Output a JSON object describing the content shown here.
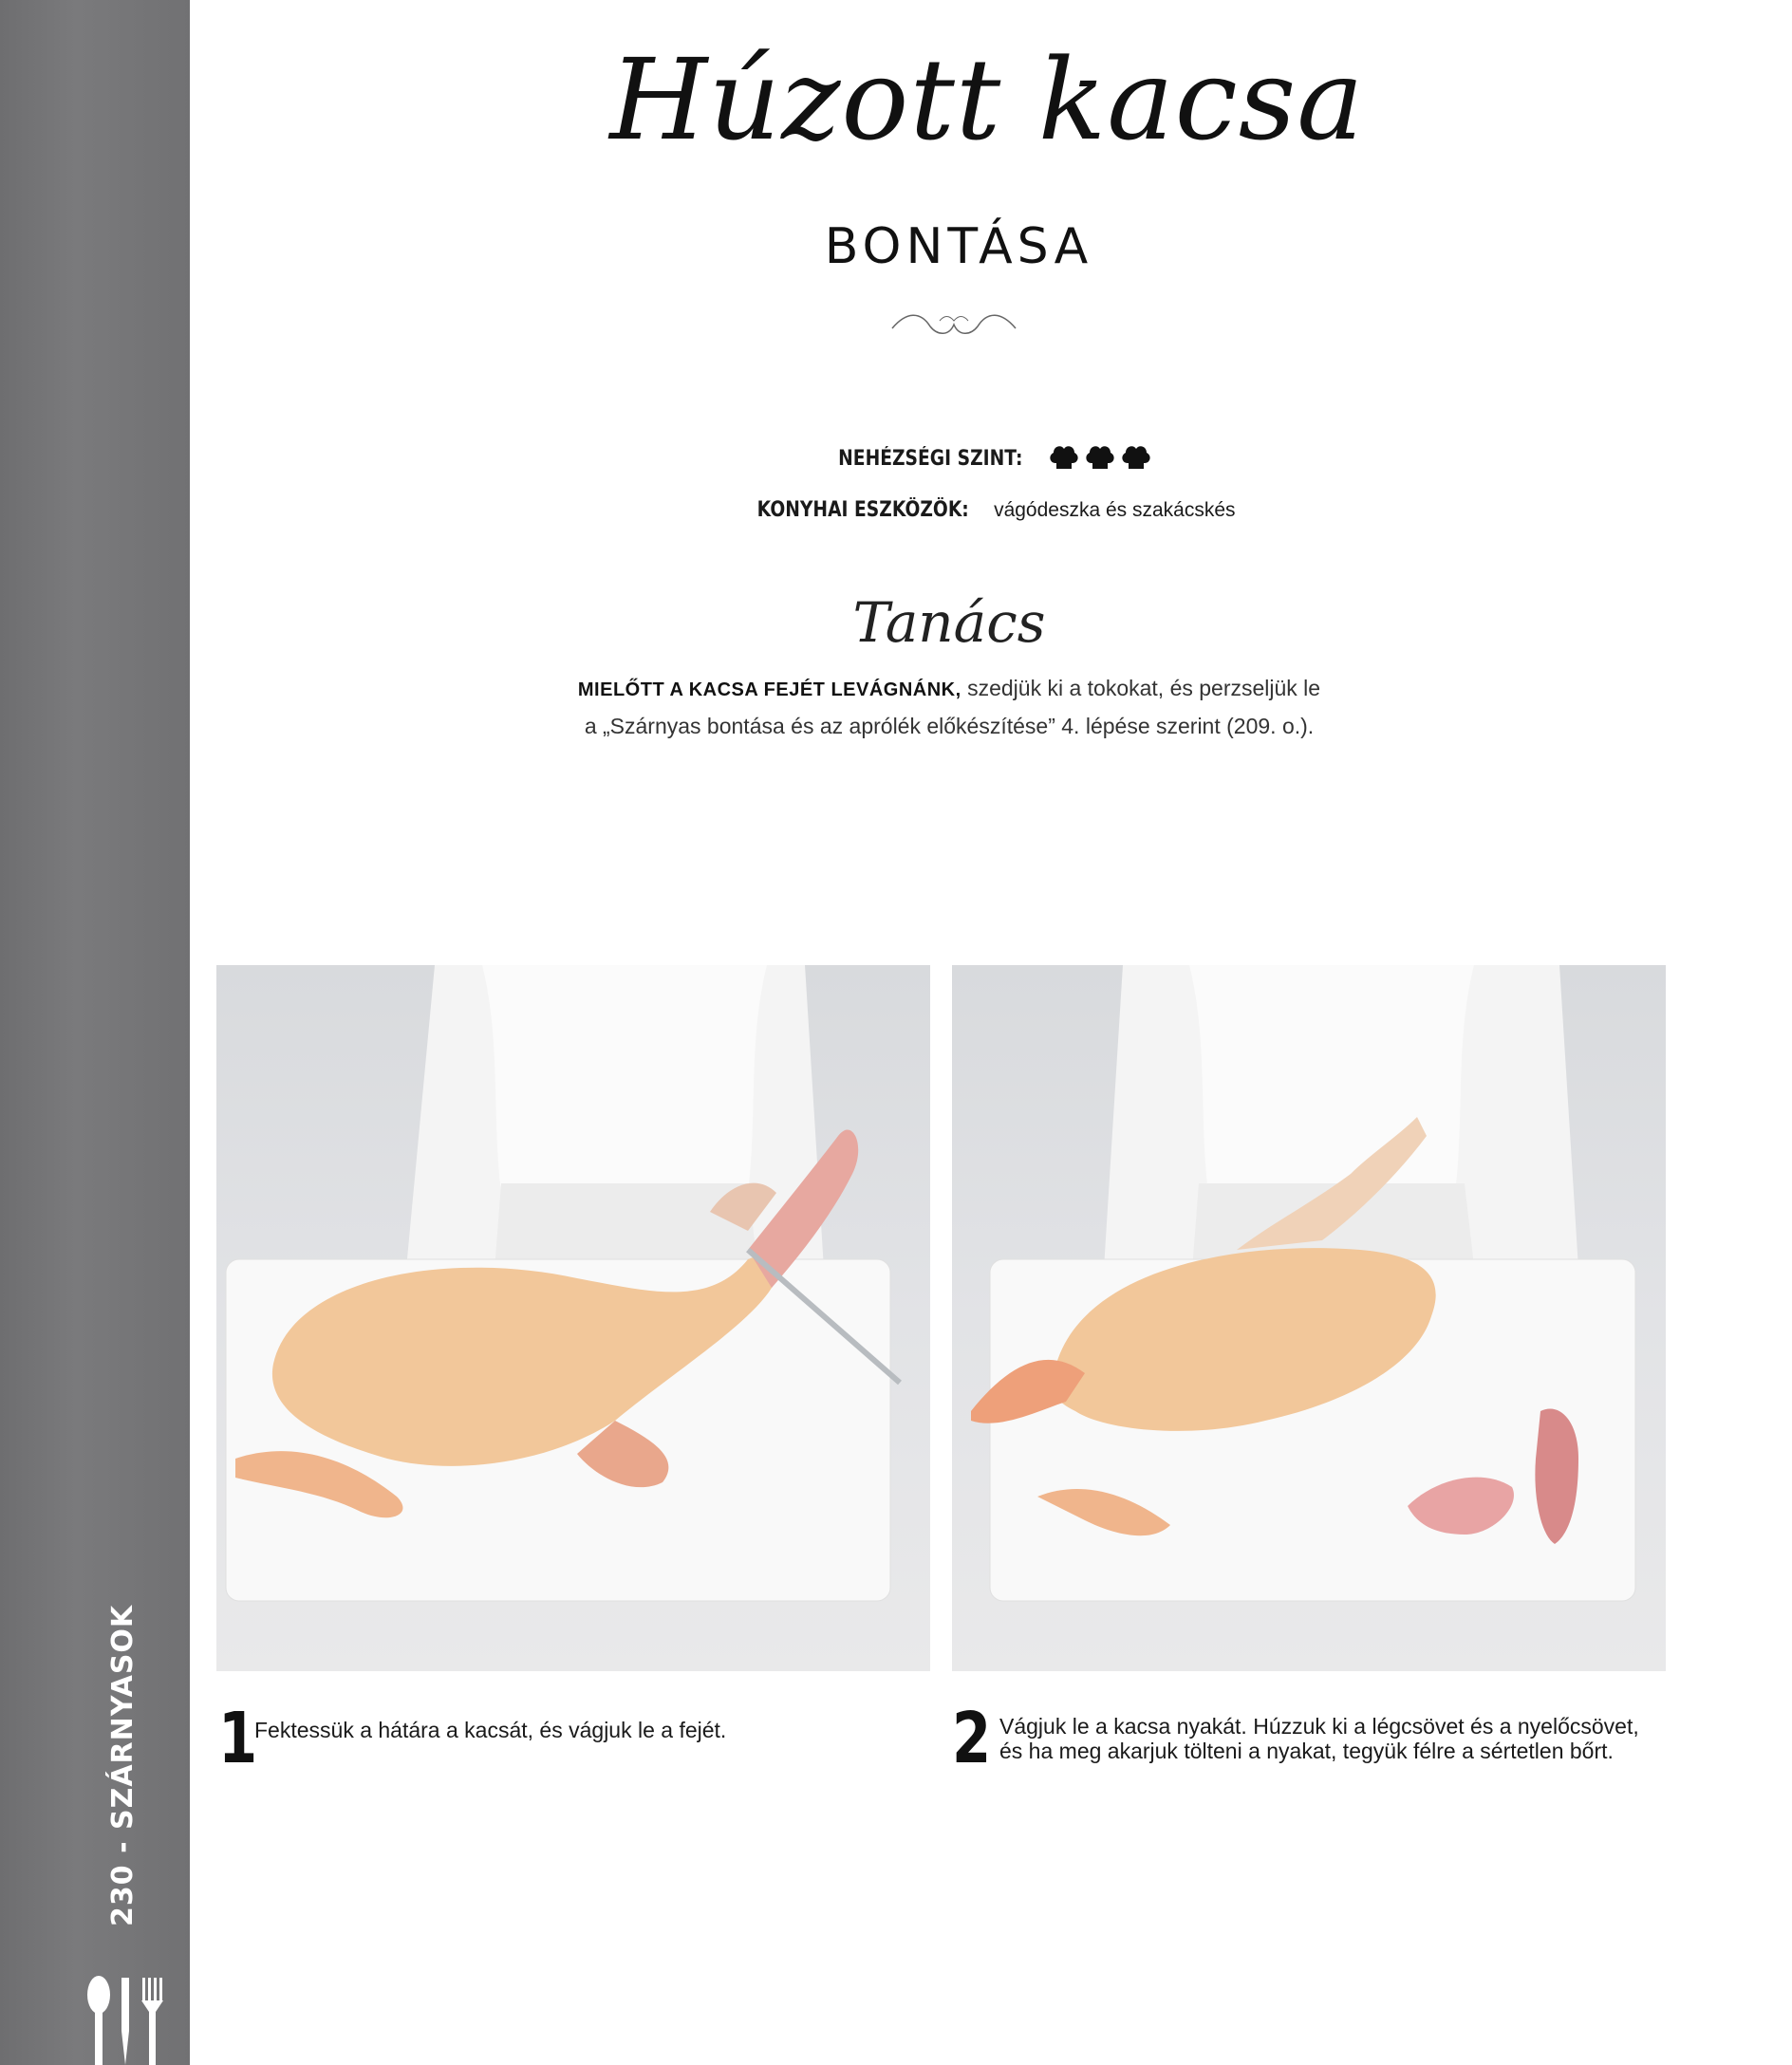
{
  "title": {
    "script": "Húzott kacsa",
    "sub": "BONTÁSA"
  },
  "meta": {
    "difficulty_label": "NEHÉZSÉGI SZINT:",
    "difficulty_level": 3,
    "tools_label": "KONYHAI ESZKÖZÖK:",
    "tools_value": "vágódeszka és szakácskés"
  },
  "tip": {
    "title": "Tanács",
    "lead": "MIELŐTT A KACSA FEJÉT LEVÁGNÁNK,",
    "line1_rest": "szedjük ki a tokokat, és perzseljük le",
    "line2": "a „Szárnyas bontása és az aprólék előkészítése” 4. lépése szerint (209. o.)."
  },
  "steps": [
    {
      "number": "1",
      "text": "Fektessük a hátára a kacsát, és vágjuk le a fejét."
    },
    {
      "number": "2",
      "line1": "Vágjuk le a kacsa nyakát. Húzzuk ki a légcsövet és a nyelőcsövet,",
      "line2": "és ha meg akarjuk tölteni a nyakat, tegyük félre a sértetlen bőrt."
    }
  ],
  "sidebar": {
    "page_label": "230 - SZÁRNYASOK"
  },
  "icons": {
    "difficulty": "chef-hat-icon",
    "cutlery": "cutlery-icon",
    "ornament": "flourish-ornament"
  },
  "colors": {
    "sidebar": "#737375",
    "text": "#1a1a1a",
    "duck_skin": "#f2c79a"
  }
}
